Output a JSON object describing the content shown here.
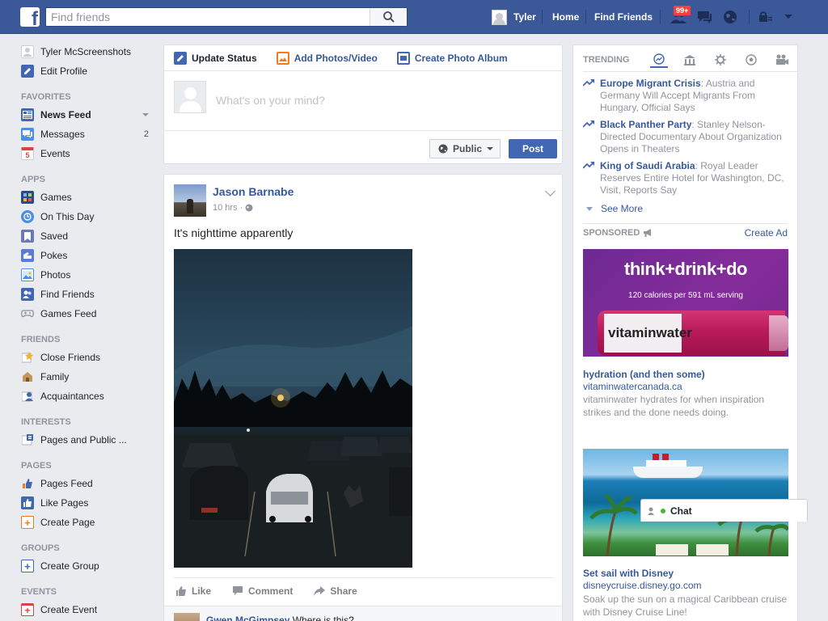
{
  "topbar": {
    "logo": "f",
    "search_placeholder": "Find friends",
    "user_name": "Tyler",
    "nav": [
      "Home",
      "Find Friends"
    ],
    "notification_count": "99+"
  },
  "sidebar": {
    "profile": [
      {
        "label": "Tyler McScreenshots",
        "icon": "avatar-icon"
      },
      {
        "label": "Edit Profile",
        "icon": "pencil-icon"
      }
    ],
    "favorites_head": "FAVORITES",
    "favorites": [
      {
        "label": "News Feed",
        "icon": "news-feed-icon",
        "color": "#4267b2"
      },
      {
        "label": "Messages",
        "icon": "messages-icon",
        "color": "#4a8fe2",
        "count": "2"
      },
      {
        "label": "Events",
        "icon": "events-icon",
        "color": "#d9453d",
        "glyph": "5"
      }
    ],
    "apps_head": "APPS",
    "apps": [
      {
        "label": "Games",
        "icon": "games-icon",
        "color": "#2d4a86"
      },
      {
        "label": "On This Day",
        "icon": "on-this-day-icon",
        "color": "#4a8fe2"
      },
      {
        "label": "Saved",
        "icon": "saved-icon",
        "color": "#6b79b4"
      },
      {
        "label": "Pokes",
        "icon": "pokes-icon",
        "color": "#5b7bd5"
      },
      {
        "label": "Photos",
        "icon": "photos-icon",
        "color": "#4a8fe2"
      },
      {
        "label": "Find Friends",
        "icon": "find-friends-icon",
        "color": "#4267b2"
      },
      {
        "label": "Games Feed",
        "icon": "games-feed-icon",
        "color": "#8d949e"
      }
    ],
    "friends_head": "FRIENDS",
    "friends": [
      {
        "label": "Close Friends",
        "icon": "star-icon",
        "color": "#f5b324"
      },
      {
        "label": "Family",
        "icon": "family-icon",
        "color": "#8c6b3e"
      },
      {
        "label": "Acquaintances",
        "icon": "acquaintances-icon",
        "color": "#4267b2"
      }
    ],
    "interests_head": "INTERESTS",
    "interests": [
      {
        "label": "Pages and Public ...",
        "icon": "pages-public-icon",
        "color": "#4267b2"
      }
    ],
    "pages_head": "PAGES",
    "pages": [
      {
        "label": "Pages Feed",
        "icon": "pages-feed-icon",
        "color": "#f07b1e"
      },
      {
        "label": "Like Pages",
        "icon": "like-pages-icon",
        "color": "#4267b2"
      },
      {
        "label": "Create Page",
        "icon": "create-page-icon",
        "color": "#f07b1e",
        "glyph": "+"
      }
    ],
    "groups_head": "GROUPS",
    "groups": [
      {
        "label": "Create Group",
        "icon": "create-group-icon",
        "color": "#4267b2",
        "glyph": "+"
      }
    ],
    "events_head": "EVENTS",
    "events": [
      {
        "label": "Create Event",
        "icon": "create-event-icon",
        "color": "#d9453d",
        "glyph": "+"
      }
    ]
  },
  "composer": {
    "tabs": [
      "Update Status",
      "Add Photos/Video",
      "Create Photo Album"
    ],
    "placeholder": "What's on your mind?",
    "privacy_label": "Public",
    "post_label": "Post"
  },
  "post": {
    "author": "Jason Barnabe",
    "time": "10 hrs ·",
    "text": "It's nighttime apparently",
    "actions": [
      "Like",
      "Comment",
      "Share"
    ],
    "comment_author": "Gwen McGimpsey",
    "comment_text": "Where is this?"
  },
  "trending": {
    "head": "TRENDING",
    "items": [
      {
        "title": "Europe Migrant Crisis",
        "desc": ": Austria and Germany Will Accept Migrants From Hungary, Official Says"
      },
      {
        "title": "Black Panther Party",
        "desc": ": Stanley Nelson-Directed Documentary About Organization Opens in Theaters"
      },
      {
        "title": "King of Saudi Arabia",
        "desc": ": Royal Leader Reserves Entire Hotel for Washington, DC, Visit, Reports Say"
      }
    ],
    "see_more": "See More"
  },
  "sponsored": {
    "head": "SPONSORED",
    "create_ad": "Create Ad",
    "ads": [
      {
        "headline": "think+drink+do",
        "subline": "120 calories per 591 mL serving",
        "brand": "vitaminwater",
        "title": "hydration (and then some)",
        "url": "vitaminwatercanada.ca",
        "desc": "vitaminwater hydrates for when inspiration strikes and the done needs doing."
      },
      {
        "title": "Set sail with Disney",
        "url": "disneycruise.disney.go.com",
        "desc": "Soak up the sun on a magical Caribbean cruise with Disney Cruise Line!"
      }
    ]
  },
  "chat": {
    "label": "Chat"
  }
}
